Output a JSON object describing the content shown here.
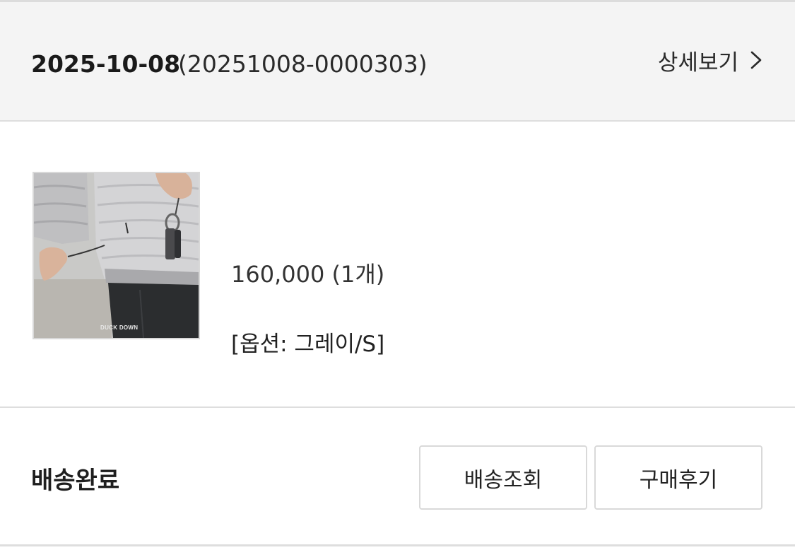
{
  "order": {
    "date": "2025-10-08",
    "number": "(20251008-0000303)",
    "detail_link_label": "상세보기"
  },
  "product": {
    "image_caption": "DUCK DOWN",
    "price_quantity": "160,000 (1개)",
    "option": "[옵션: 그레이/S]"
  },
  "status": {
    "label": "배송완료"
  },
  "actions": {
    "tracking_label": "배송조회",
    "review_label": "구매후기"
  },
  "icons": {
    "detail": "chevron-right-icon"
  },
  "colors": {
    "header_background": "#f4f4f4",
    "divider": "#dedede",
    "button_border": "#d9d9d9",
    "text": "#222222"
  }
}
